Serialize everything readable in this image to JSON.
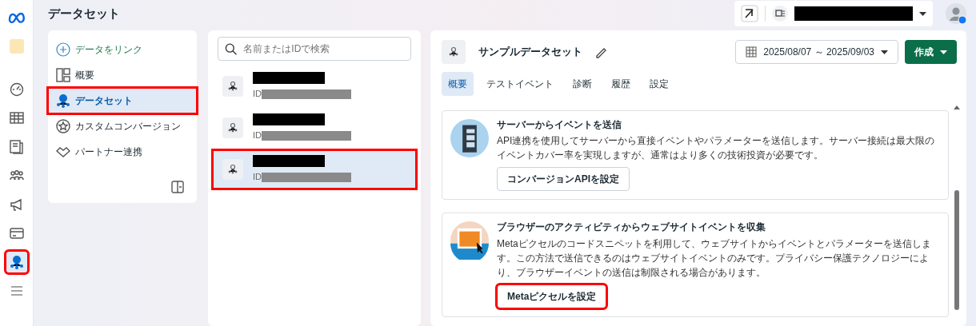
{
  "rail": {
    "items": [
      {
        "kind": "logo",
        "selected": false,
        "highlighted": false
      },
      {
        "kind": "account",
        "selected": false,
        "highlighted": false
      },
      {
        "kind": "gauge",
        "selected": false,
        "highlighted": false
      },
      {
        "kind": "table",
        "selected": false,
        "highlighted": false
      },
      {
        "kind": "pages",
        "selected": false,
        "highlighted": false
      },
      {
        "kind": "people",
        "selected": false,
        "highlighted": false
      },
      {
        "kind": "megaphone",
        "selected": false,
        "highlighted": false
      },
      {
        "kind": "card",
        "selected": false,
        "highlighted": false
      },
      {
        "kind": "dataset",
        "selected": true,
        "highlighted": true
      },
      {
        "kind": "menu",
        "selected": false,
        "highlighted": false
      }
    ]
  },
  "header": {
    "title": "データセット",
    "account": {
      "name_redacted": true
    }
  },
  "nav": {
    "items": [
      {
        "kind": "link",
        "label": "データをリンク",
        "selected": false,
        "highlighted": false
      },
      {
        "kind": "overview",
        "label": "概要",
        "selected": false,
        "highlighted": false
      },
      {
        "kind": "dataset",
        "label": "データセット",
        "selected": true,
        "highlighted": true
      },
      {
        "kind": "custom",
        "label": "カスタムコンバージョン",
        "selected": false,
        "highlighted": false
      },
      {
        "kind": "partner",
        "label": "パートナー連携",
        "selected": false,
        "highlighted": false
      }
    ]
  },
  "search": {
    "placeholder": "名前またはIDで検索"
  },
  "datasets": [
    {
      "name_redacted": true,
      "id_label": "ID",
      "id_redacted": true,
      "selected": false,
      "highlighted": false
    },
    {
      "name_redacted": true,
      "id_label": "ID",
      "id_redacted": true,
      "selected": false,
      "highlighted": false
    },
    {
      "name_redacted": true,
      "id_label": "ID",
      "id_redacted": true,
      "selected": true,
      "highlighted": true
    }
  ],
  "detail": {
    "title": "サンプルデータセット",
    "date_range": "2025/08/07 ～ 2025/09/03",
    "create_button": "作成",
    "tabs": [
      {
        "label": "概要",
        "selected": true
      },
      {
        "label": "テストイベント",
        "selected": false
      },
      {
        "label": "診断",
        "selected": false
      },
      {
        "label": "履歴",
        "selected": false
      },
      {
        "label": "設定",
        "selected": false
      }
    ],
    "cards": [
      {
        "kind": "server",
        "title": "サーバーからイベントを送信",
        "description": "API連携を使用してサーバーから直接イベントやパラメーターを送信します。サーバー接続は最大限のイベントカバー率を実現しますが、通常はより多くの技術投資が必要です。",
        "button": {
          "label": "コンバージョンAPIを設定",
          "highlighted": false
        }
      },
      {
        "kind": "browser",
        "title": "ブラウザーのアクティビティからウェブサイトイベントを収集",
        "description": "Metaピクセルのコードスニペットを利用して、ウェブサイトからイベントとパラメーターを送信します。この方法で送信できるのはウェブサイトイベントのみです。プライバシー保護テクノロジーにより、ブラウザーイベントの送信は制限される場合があります。",
        "button": {
          "label": "Metaピクセルを設定",
          "highlighted": true
        }
      }
    ]
  }
}
